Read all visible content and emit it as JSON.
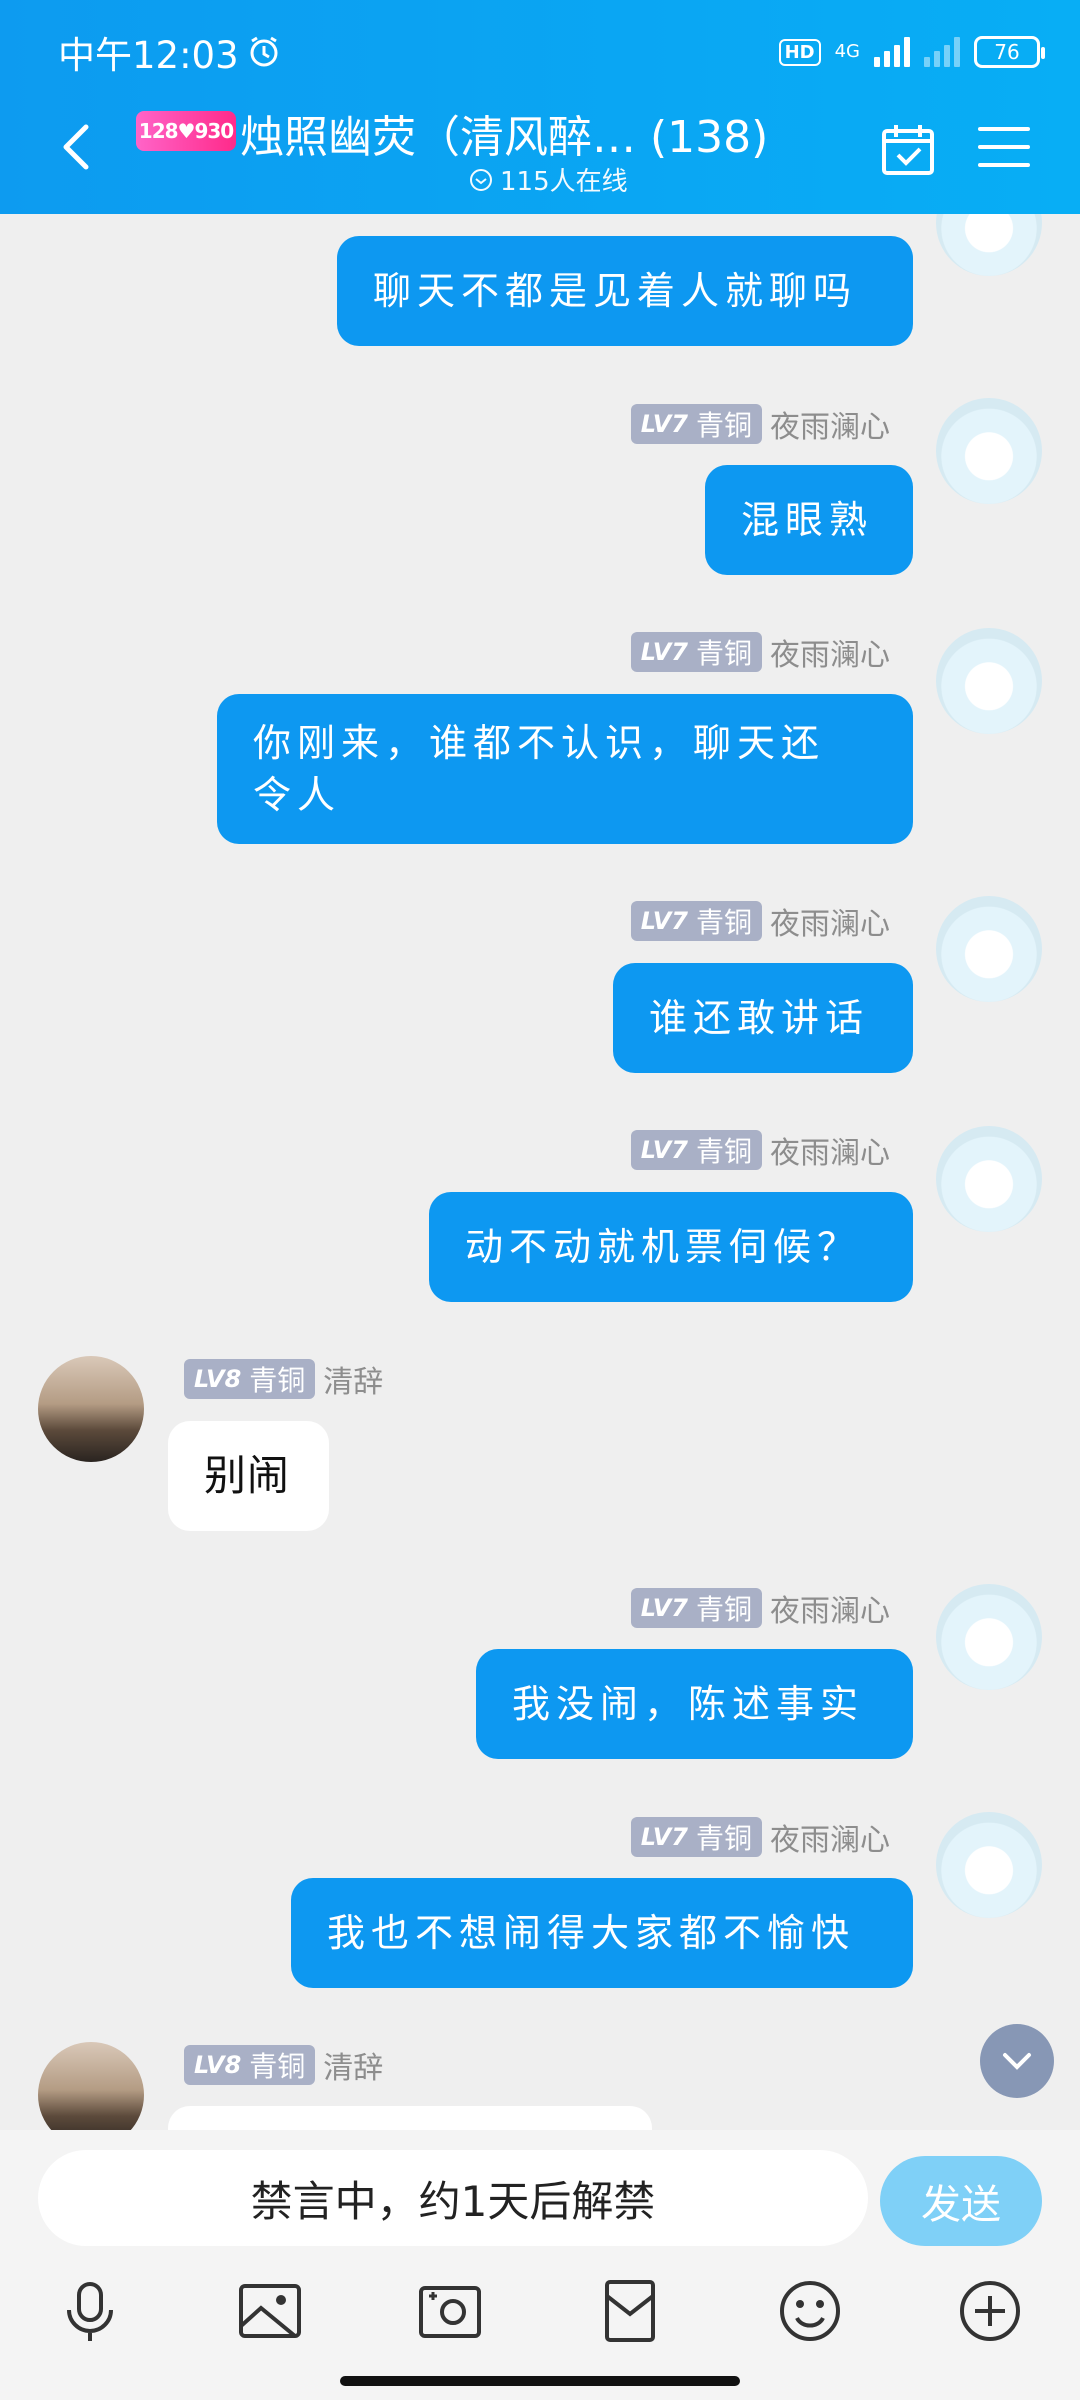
{
  "status": {
    "time": "中午12:03",
    "hd": "HD",
    "network": "4G",
    "battery": "76"
  },
  "header": {
    "group_tag": "128♥930",
    "title": "烛照幽荧（清风醉…  (138)",
    "online": "115人在线"
  },
  "messages": [
    {
      "side": "right",
      "text": "聊天不都是见着人就聊吗"
    },
    {
      "side": "right",
      "level": "LV7",
      "rank": "青铜",
      "name": "夜雨澜心",
      "text": "混眼熟"
    },
    {
      "side": "right",
      "level": "LV7",
      "rank": "青铜",
      "name": "夜雨澜心",
      "text": "你刚来，谁都不认识，聊天还",
      "text2": "令人"
    },
    {
      "side": "right",
      "level": "LV7",
      "rank": "青铜",
      "name": "夜雨澜心",
      "text": "谁还敢讲话"
    },
    {
      "side": "right",
      "level": "LV7",
      "rank": "青铜",
      "name": "夜雨澜心",
      "text": "动不动就机票伺候？"
    },
    {
      "side": "left",
      "level": "LV8",
      "rank": "青铜",
      "name": "清辞",
      "text": "别闹"
    },
    {
      "side": "right",
      "level": "LV7",
      "rank": "青铜",
      "name": "夜雨澜心",
      "text": "我没闹，陈述事实"
    },
    {
      "side": "right",
      "level": "LV7",
      "rank": "青铜",
      "name": "夜雨澜心",
      "text": "我也不想闹得大家都不愉快"
    },
    {
      "side": "left",
      "level": "LV8",
      "rank": "青铜",
      "name": "清辞",
      "text": ""
    }
  ],
  "input": {
    "placeholder": "禁言中，约1天后解禁",
    "send_label": "发送"
  },
  "tools": [
    "microphone-icon",
    "image-icon",
    "camera-icon",
    "red-packet-icon",
    "emoji-icon",
    "plus-icon"
  ]
}
